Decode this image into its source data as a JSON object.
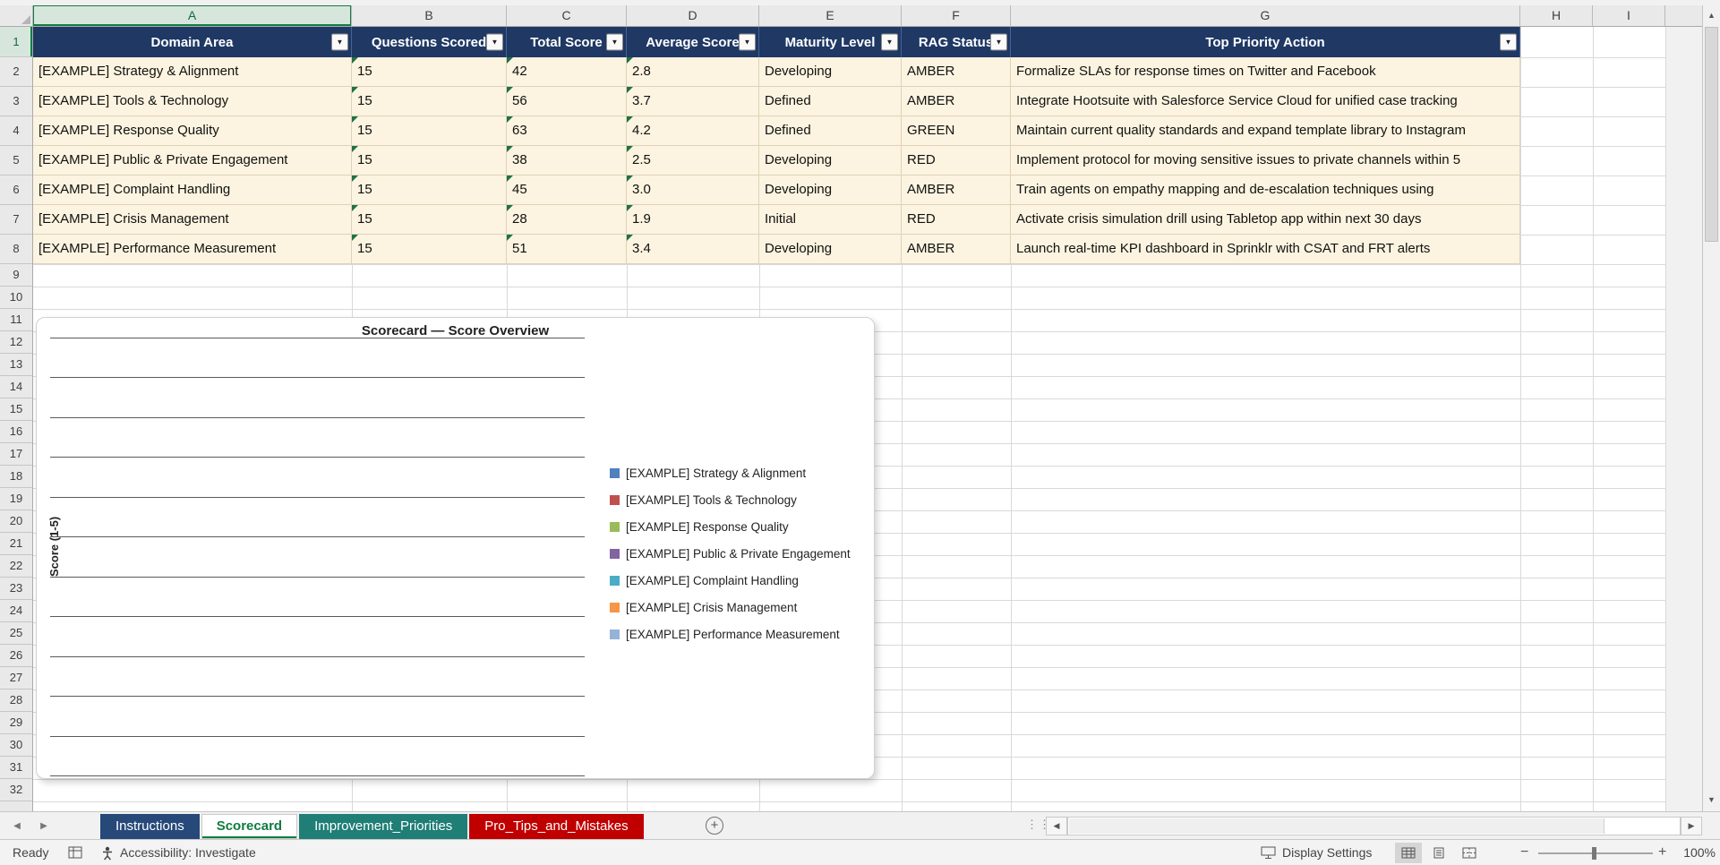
{
  "sheet": {
    "columns": [
      "A",
      "B",
      "C",
      "D",
      "E",
      "F",
      "G",
      "H",
      "I"
    ],
    "rows": [
      "1",
      "2",
      "3",
      "4",
      "5",
      "6",
      "7",
      "8",
      "9",
      "10",
      "11",
      "12",
      "13",
      "14",
      "15",
      "16",
      "17",
      "18",
      "19",
      "20",
      "21",
      "22",
      "23",
      "24",
      "25",
      "26",
      "27",
      "28",
      "29",
      "30",
      "31",
      "32"
    ],
    "active_cell_column": "A",
    "active_cell_row": "1"
  },
  "table": {
    "headers": [
      "Domain Area",
      "Questions Scored",
      "Total Score",
      "Average Score",
      "Maturity Level",
      "RAG Status",
      "Top Priority Action"
    ],
    "header_fill": "#1F3864",
    "data_fill": "#FCF4E0",
    "rows": [
      [
        "[EXAMPLE] Strategy & Alignment",
        "15",
        "42",
        "2.8",
        "Developing",
        "AMBER",
        "Formalize SLAs for response times on Twitter and Facebook"
      ],
      [
        "[EXAMPLE] Tools & Technology",
        "15",
        "56",
        "3.7",
        "Defined",
        "AMBER",
        "Integrate Hootsuite with Salesforce Service Cloud for unified case tracking"
      ],
      [
        "[EXAMPLE] Response Quality",
        "15",
        "63",
        "4.2",
        "Defined",
        "GREEN",
        "Maintain current quality standards and expand template library to Instagram"
      ],
      [
        "[EXAMPLE] Public & Private Engagement",
        "15",
        "38",
        "2.5",
        "Developing",
        "RED",
        "Implement protocol for moving sensitive issues to private channels within 5"
      ],
      [
        "[EXAMPLE] Complaint Handling",
        "15",
        "45",
        "3.0",
        "Developing",
        "AMBER",
        "Train agents on empathy mapping and de-escalation techniques using"
      ],
      [
        "[EXAMPLE] Crisis Management",
        "15",
        "28",
        "1.9",
        "Initial",
        "RED",
        "Activate crisis simulation drill using Tabletop app within next 30 days"
      ],
      [
        "[EXAMPLE] Performance Measurement",
        "15",
        "51",
        "3.4",
        "Developing",
        "AMBER",
        "Launch real-time KPI dashboard in Sprinklr with CSAT and FRT alerts"
      ]
    ]
  },
  "chart_data": {
    "type": "bar",
    "title": "Scorecard — Score Overview",
    "xlabel": "",
    "ylabel": "Score (1-5)",
    "ylim": [
      1,
      5
    ],
    "grid": true,
    "legend_position": "right",
    "plot_rendered_empty": true,
    "series": [
      {
        "name": "[EXAMPLE] Strategy & Alignment",
        "color": "#4F81BD",
        "values": []
      },
      {
        "name": "[EXAMPLE] Tools & Technology",
        "color": "#C0504D",
        "values": []
      },
      {
        "name": "[EXAMPLE] Response Quality",
        "color": "#9BBB59",
        "values": []
      },
      {
        "name": "[EXAMPLE] Public & Private Engagement",
        "color": "#8064A2",
        "values": []
      },
      {
        "name": "[EXAMPLE] Complaint Handling",
        "color": "#4BACC6",
        "values": []
      },
      {
        "name": "[EXAMPLE] Crisis Management",
        "color": "#F79646",
        "values": []
      },
      {
        "name": "[EXAMPLE] Performance Measurement",
        "color": "#95B3D7",
        "values": []
      }
    ]
  },
  "tabs": {
    "items": [
      {
        "label": "Instructions",
        "color": "#27497A",
        "text_color": "#FFFFFF",
        "active": false
      },
      {
        "label": "Scorecard",
        "color": "#FFFFFF",
        "text_color": "#107C41",
        "active": true
      },
      {
        "label": "Improvement_Priorities",
        "color": "#1F7E76",
        "text_color": "#FFFFFF",
        "active": false
      },
      {
        "label": "Pro_Tips_and_Mistakes",
        "color": "#C00000",
        "text_color": "#FFFFFF",
        "active": false
      }
    ],
    "add_sheet_label": "+"
  },
  "status_bar": {
    "ready": "Ready",
    "accessibility": "Accessibility: Investigate",
    "display_settings": "Display Settings",
    "zoom": "100%"
  },
  "icons": {
    "filter_dropdown": "▼",
    "tab_scroll_left": "◀",
    "tab_scroll_right": "▶",
    "scroll_up": "▲",
    "scroll_down": "▼",
    "scroll_left": "◀",
    "scroll_right": "▶",
    "zoom_out": "−",
    "zoom_in": "+",
    "grip": "⋮⋮"
  }
}
